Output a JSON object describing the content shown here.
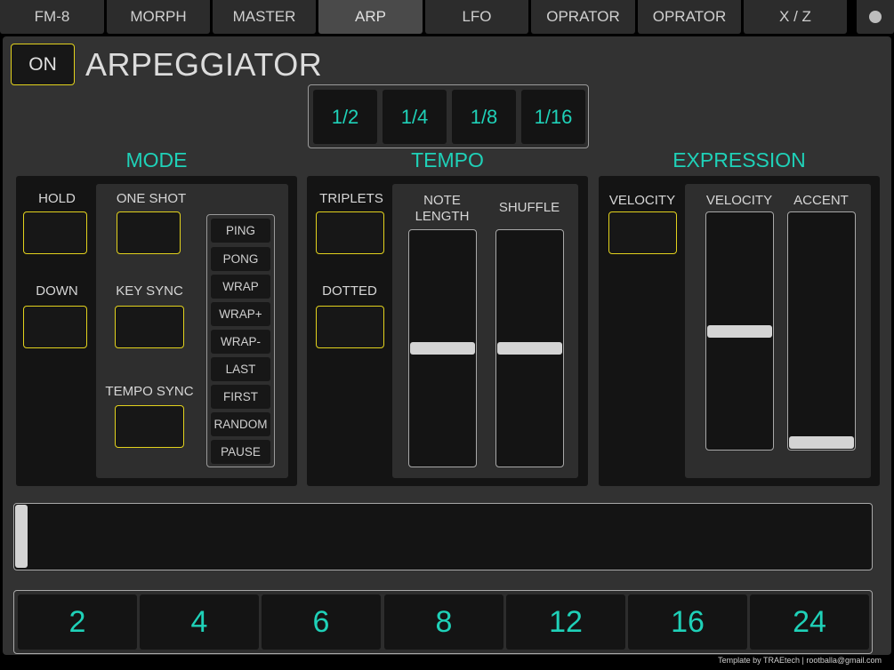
{
  "tabs": [
    {
      "label": "FM-8"
    },
    {
      "label": "MORPH"
    },
    {
      "label": "MASTER"
    },
    {
      "label": "ARP",
      "active": true
    },
    {
      "label": "LFO"
    },
    {
      "label": "OPRATOR"
    },
    {
      "label": "OPRATOR"
    },
    {
      "label": "X / Z"
    }
  ],
  "header": {
    "on_label": "ON",
    "title": "ARPEGGIATOR"
  },
  "rates": [
    "1/2",
    "1/4",
    "1/8",
    "1/16"
  ],
  "mode": {
    "title": "MODE",
    "hold_label": "HOLD",
    "down_label": "DOWN",
    "one_shot_label": "ONE SHOT",
    "key_sync_label": "KEY SYNC",
    "tempo_sync_label": "TEMPO SYNC",
    "patterns": [
      "PING",
      "PONG",
      "WRAP",
      "WRAP+",
      "WRAP-",
      "LAST",
      "FIRST",
      "RANDOM",
      "PAUSE"
    ]
  },
  "tempo": {
    "title": "TEMPO",
    "triplets_label": "TRIPLETS",
    "dotted_label": "DOTTED",
    "note_length_label_1": "NOTE",
    "note_length_label_2": "LENGTH",
    "shuffle_label": "SHUFFLE",
    "note_length_value": 0.5,
    "shuffle_value": 0.5
  },
  "expression": {
    "title": "EXPRESSION",
    "velocity_toggle_label": "VELOCITY",
    "velocity_slider_label": "VELOCITY",
    "accent_label": "ACCENT",
    "velocity_value": 0.5,
    "accent_value": 0.0
  },
  "sequence": {
    "position": 0.0
  },
  "steps": [
    "2",
    "4",
    "6",
    "8",
    "12",
    "16",
    "24"
  ],
  "footer": "Template by TRAEtech | rootballa@gmail.com",
  "colors": {
    "accent": "#1fd1b8",
    "toggle_border": "#e2d21d",
    "background": "#323232"
  }
}
